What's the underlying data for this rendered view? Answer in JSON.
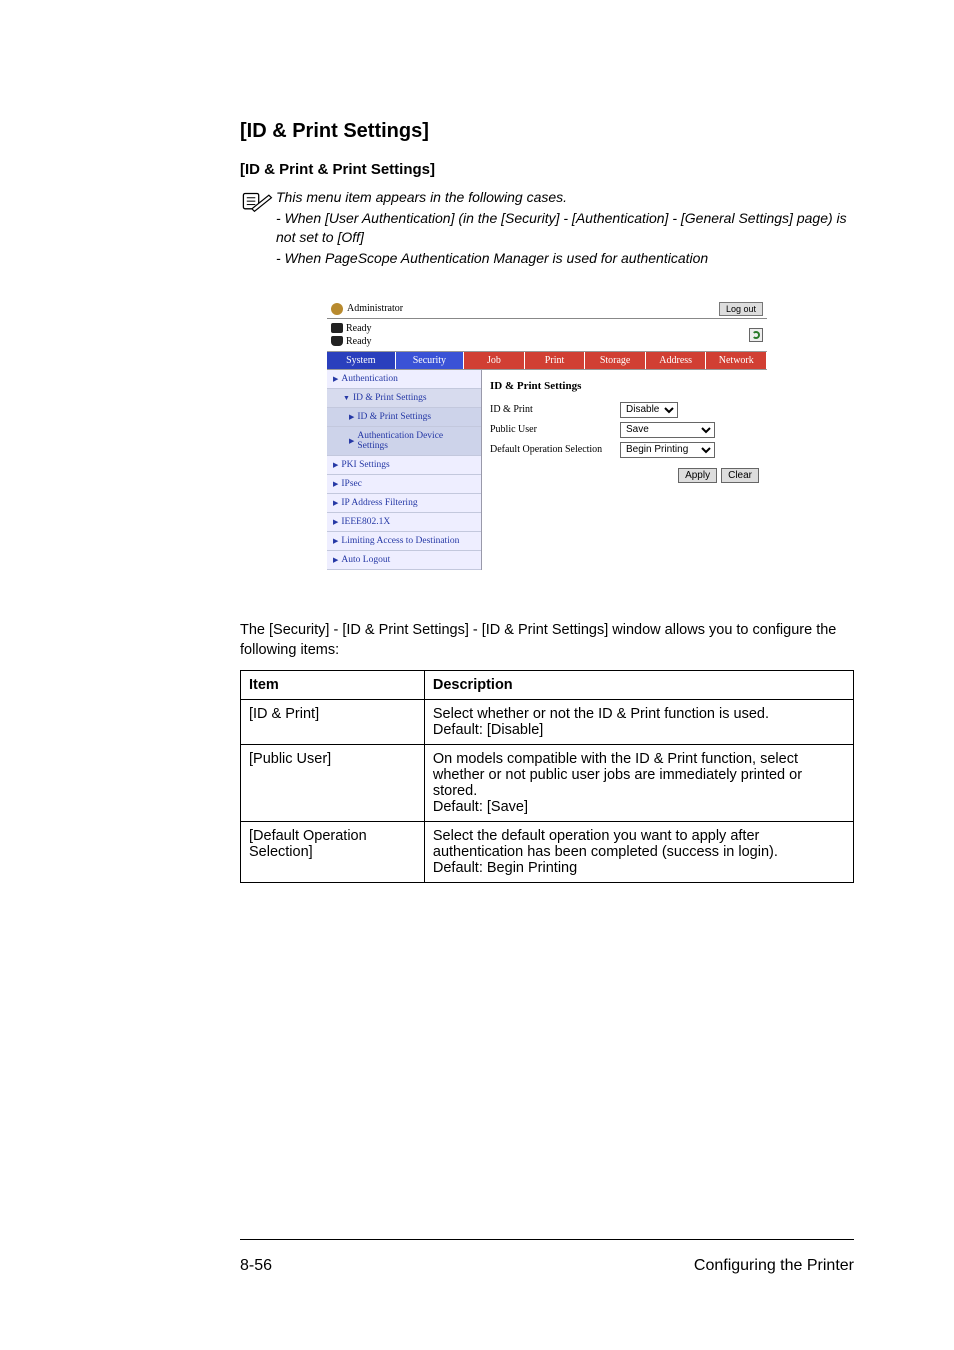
{
  "section": {
    "title": "[ID & Print Settings]",
    "subtitle": "[ID & Print & Print Settings]"
  },
  "note": {
    "line1": "This menu item appears in the following cases.",
    "line2": "- When [User Authentication] (in the [Security] - [Authentication] - [General Settings] page) is not set to [Off]",
    "line3": "- When PageScope Authentication Manager is used for authentication"
  },
  "app": {
    "header_user": "Administrator",
    "logout": "Log out",
    "status1": "Ready",
    "status2": "Ready",
    "tabs": {
      "system": "System",
      "security": "Security",
      "job": "Job",
      "print": "Print",
      "storage": "Storage",
      "address": "Address",
      "network": "Network"
    },
    "sidebar": [
      "Authentication",
      "ID & Print Settings",
      "ID & Print Settings",
      "Authentication Device Settings",
      "PKI Settings",
      "IPsec",
      "IP Address Filtering",
      "IEEE802.1X",
      "Limiting Access to Destination",
      "Auto Logout"
    ],
    "pane_title": "ID & Print Settings",
    "form": {
      "label1": "ID & Print",
      "value1": "Disable",
      "label2": "Public User",
      "value2": "Save",
      "label3": "Default Operation Selection",
      "value3": "Begin Printing"
    },
    "buttons": {
      "apply": "Apply",
      "clear": "Clear"
    }
  },
  "body_text": "The [Security] - [ID & Print Settings] - [ID & Print Settings] window allows you to configure the following items:",
  "table": {
    "head_item": "Item",
    "head_desc": "Description",
    "rows": [
      {
        "item": "[ID & Print]",
        "desc": "Select whether or not the ID & Print function is used.\nDefault: [Disable]"
      },
      {
        "item": "[Public User]",
        "desc": "On models compatible with the ID & Print function, select whether or not public user jobs are immediately printed or stored.\nDefault: [Save]"
      },
      {
        "item": "[Default Operation Selection]",
        "desc": "Select the default operation you want to apply after authentication has been completed (success in login).\nDefault: Begin Printing"
      }
    ]
  },
  "footer": {
    "pagenum": "8-56",
    "section_name": "Configuring the Printer"
  }
}
